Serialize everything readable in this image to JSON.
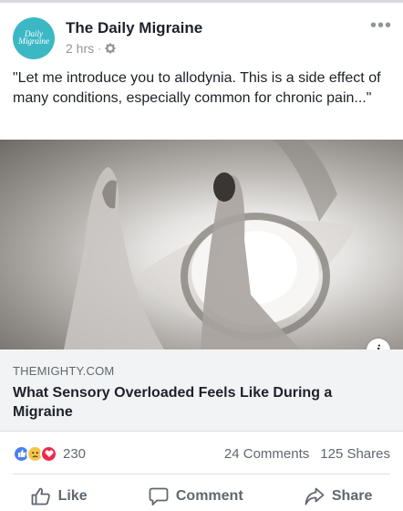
{
  "post": {
    "page_name": "The Daily Migraine",
    "avatar_line1": "Daily",
    "avatar_line2": "Migraine",
    "time": "2 hrs",
    "separator": "·",
    "privacy_icon": "gear-icon",
    "more_label": "•••",
    "text": "\"Let me introduce you to allodynia. This is a side effect of many conditions, especially common for chronic pain...\""
  },
  "link": {
    "domain": "THEMIGHTY.COM",
    "headline": "What Sensory Overloaded Feels Like During a Migraine",
    "info_label": "i"
  },
  "stats": {
    "reaction_count": "230",
    "comments": "24 Comments",
    "shares": "125 Shares",
    "reaction_icons": [
      "like-icon",
      "sad-icon",
      "love-icon"
    ]
  },
  "actions": {
    "like": "Like",
    "comment": "Comment",
    "share": "Share"
  },
  "colors": {
    "avatar_bg": "#3cb8c4",
    "like_blue": "#4c80f0",
    "love_red": "#f0284a",
    "sad_yellow": "#f3c64b",
    "caption_bg": "#f2f3f5"
  }
}
